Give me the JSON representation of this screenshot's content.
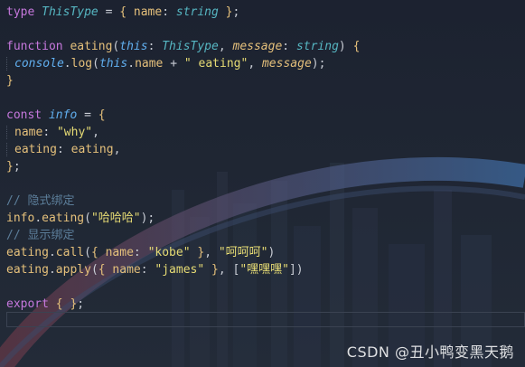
{
  "code_lines": [
    [
      [
        "kw",
        "type "
      ],
      [
        "type",
        "ThisType"
      ],
      [
        "punc",
        " = "
      ],
      [
        "brace",
        "{"
      ],
      [
        "punc",
        " "
      ],
      [
        "prop",
        "name"
      ],
      [
        "punc",
        ": "
      ],
      [
        "type",
        "string"
      ],
      [
        "punc",
        " "
      ],
      [
        "brace",
        "}"
      ],
      [
        "punc",
        ";"
      ]
    ],
    [],
    [
      [
        "kw",
        "function "
      ],
      [
        "fn",
        "eating"
      ],
      [
        "punc",
        "("
      ],
      [
        "this",
        "this"
      ],
      [
        "punc",
        ": "
      ],
      [
        "type",
        "ThisType"
      ],
      [
        "punc",
        ", "
      ],
      [
        "param",
        "message"
      ],
      [
        "punc",
        ": "
      ],
      [
        "type",
        "string"
      ],
      [
        "punc",
        ") "
      ],
      [
        "brace",
        "{"
      ]
    ],
    [
      [
        "guide",
        ""
      ],
      [
        "obj",
        "console"
      ],
      [
        "punc",
        "."
      ],
      [
        "fn",
        "log"
      ],
      [
        "punc",
        "("
      ],
      [
        "this",
        "this"
      ],
      [
        "punc",
        "."
      ],
      [
        "prop",
        "name"
      ],
      [
        "punc",
        " + "
      ],
      [
        "str",
        "\" eating\""
      ],
      [
        "punc",
        ", "
      ],
      [
        "param",
        "message"
      ],
      [
        "punc",
        ");"
      ]
    ],
    [
      [
        "brace",
        "}"
      ]
    ],
    [],
    [
      [
        "kw",
        "const "
      ],
      [
        "obj",
        "info"
      ],
      [
        "punc",
        " = "
      ],
      [
        "brace",
        "{"
      ]
    ],
    [
      [
        "guide",
        ""
      ],
      [
        "prop",
        "name"
      ],
      [
        "punc",
        ": "
      ],
      [
        "str",
        "\"why\""
      ],
      [
        "punc",
        ","
      ]
    ],
    [
      [
        "guide",
        ""
      ],
      [
        "prop",
        "eating"
      ],
      [
        "punc",
        ": "
      ],
      [
        "fn",
        "eating"
      ],
      [
        "punc",
        ","
      ]
    ],
    [
      [
        "brace",
        "}"
      ],
      [
        "punc",
        ";"
      ]
    ],
    [],
    [
      [
        "comment",
        "// 隐式绑定"
      ]
    ],
    [
      [
        "fn",
        "info"
      ],
      [
        "punc",
        "."
      ],
      [
        "fn",
        "eating"
      ],
      [
        "punc",
        "("
      ],
      [
        "str",
        "\"哈哈哈\""
      ],
      [
        "punc",
        ");"
      ]
    ],
    [
      [
        "comment",
        "// 显示绑定"
      ]
    ],
    [
      [
        "fn",
        "eating"
      ],
      [
        "punc",
        "."
      ],
      [
        "fn",
        "call"
      ],
      [
        "punc",
        "("
      ],
      [
        "brace",
        "{"
      ],
      [
        "punc",
        " "
      ],
      [
        "prop",
        "name"
      ],
      [
        "punc",
        ": "
      ],
      [
        "str",
        "\"kobe\""
      ],
      [
        "punc",
        " "
      ],
      [
        "brace",
        "}"
      ],
      [
        "punc",
        ", "
      ],
      [
        "str",
        "\"呵呵呵\""
      ],
      [
        "punc",
        ")"
      ]
    ],
    [
      [
        "fn",
        "eating"
      ],
      [
        "punc",
        "."
      ],
      [
        "fn",
        "apply"
      ],
      [
        "punc",
        "("
      ],
      [
        "brace",
        "{"
      ],
      [
        "punc",
        " "
      ],
      [
        "prop",
        "name"
      ],
      [
        "punc",
        ": "
      ],
      [
        "str",
        "\"james\""
      ],
      [
        "punc",
        " "
      ],
      [
        "brace",
        "}"
      ],
      [
        "punc",
        ", ["
      ],
      [
        "str",
        "\"嘿嘿嘿\""
      ],
      [
        "punc",
        "])"
      ]
    ],
    [],
    [
      [
        "kw",
        "export "
      ],
      [
        "brace",
        "{"
      ],
      [
        "punc",
        " "
      ],
      [
        "brace",
        "}"
      ],
      [
        "punc",
        ";"
      ]
    ]
  ],
  "watermark": "CSDN @丑小鸭变黑天鹅"
}
